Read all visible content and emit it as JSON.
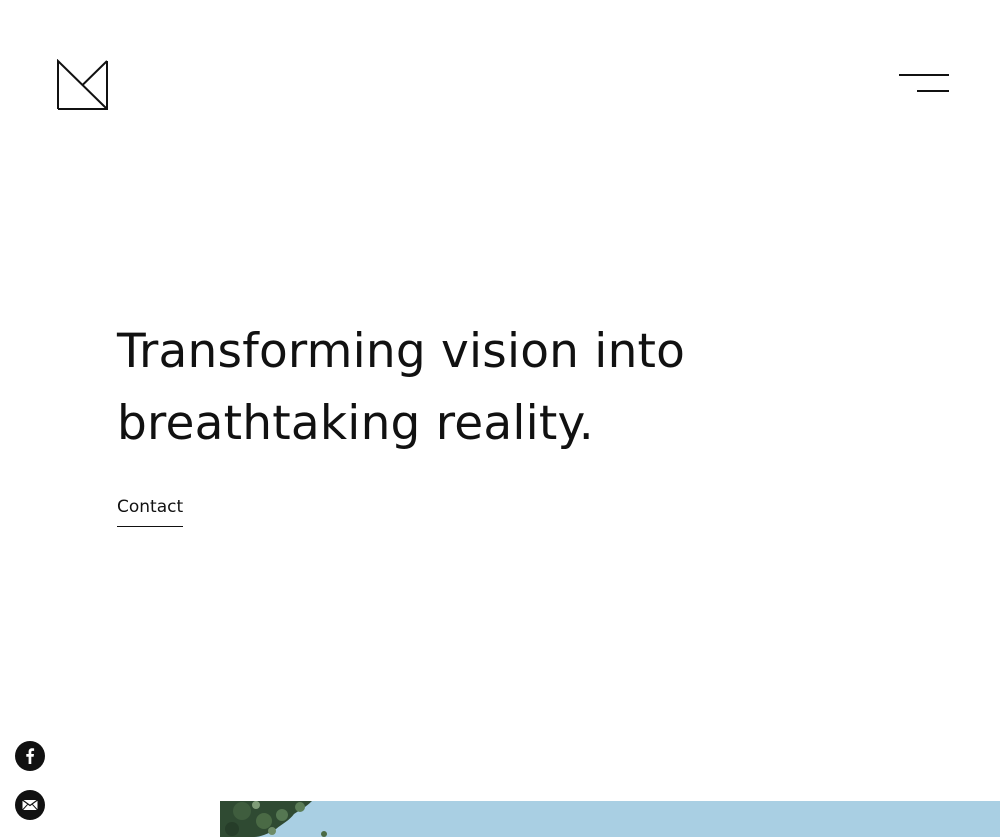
{
  "header": {
    "logo_icon": "monogram-mk-logo",
    "menu_icon": "hamburger-menu-icon"
  },
  "hero": {
    "heading_line_1": "Transforming vision into",
    "heading_line_2": "breathtaking reality.",
    "contact_label": "Contact"
  },
  "social": {
    "facebook_icon": "facebook-icon",
    "email_icon": "email-icon"
  },
  "colors": {
    "text": "#111111",
    "background": "#ffffff",
    "sky": "#a9cfe3",
    "foliage": "#2f4a32"
  }
}
